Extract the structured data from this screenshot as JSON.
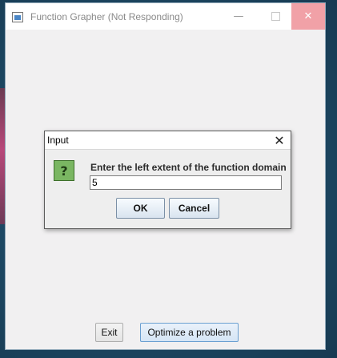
{
  "window": {
    "title": "Function Grapher (Not Responding)",
    "minimize_glyph": "—",
    "close_glyph": "✕"
  },
  "buttons": {
    "exit": "Exit",
    "optimize": "Optimize a problem"
  },
  "dialog": {
    "title": "Input",
    "close_glyph": "✕",
    "icon_glyph": "?",
    "message": "Enter the left extent of the function domain",
    "input_value": "5",
    "ok": "OK",
    "cancel": "Cancel"
  },
  "icons": {
    "app": "app-window-icon",
    "question": "question-icon",
    "close": "close-icon"
  },
  "colors": {
    "close_hover": "#f1a1a7",
    "question_icon": "#7ab662",
    "default_button_border": "#6a9fd1"
  }
}
